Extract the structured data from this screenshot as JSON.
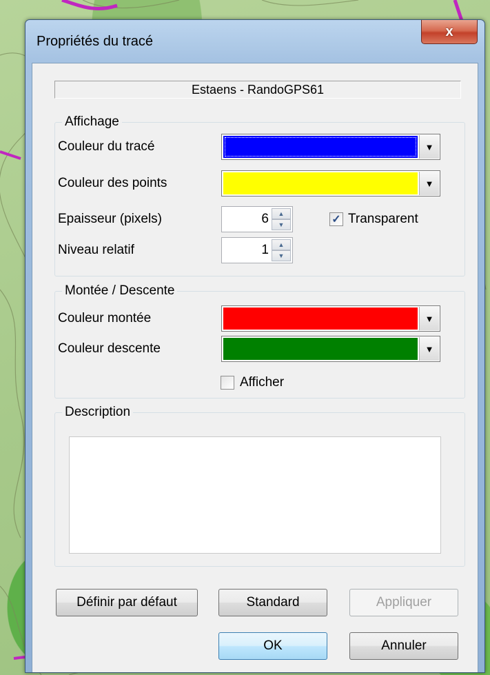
{
  "window": {
    "title": "Propriétés du tracé",
    "close_glyph": "x"
  },
  "track_name": "Estaens - RandoGPS61",
  "affichage": {
    "group_label": "Affichage",
    "track_color_label": "Couleur du tracé",
    "track_color": "#0000ff",
    "points_color_label": "Couleur des points",
    "points_color": "#ffff00",
    "thickness_label": "Epaisseur (pixels)",
    "thickness_value": "6",
    "transparent_label": "Transparent",
    "transparent_checked": true,
    "level_label": "Niveau relatif",
    "level_value": "1"
  },
  "montee_descente": {
    "group_label": "Montée / Descente",
    "up_color_label": "Couleur montée",
    "up_color": "#ff0000",
    "down_color_label": "Couleur descente",
    "down_color": "#008000",
    "show_label": "Afficher",
    "show_checked": false
  },
  "description": {
    "group_label": "Description",
    "value": ""
  },
  "buttons": {
    "set_default": "Définir par défaut",
    "standard": "Standard",
    "apply": "Appliquer",
    "ok": "OK",
    "cancel": "Annuler"
  },
  "icons": {
    "dropdown": "chevron-down-icon",
    "spin_up": "spin-up-icon",
    "spin_down": "spin-down-icon",
    "check": "checkmark-icon"
  }
}
